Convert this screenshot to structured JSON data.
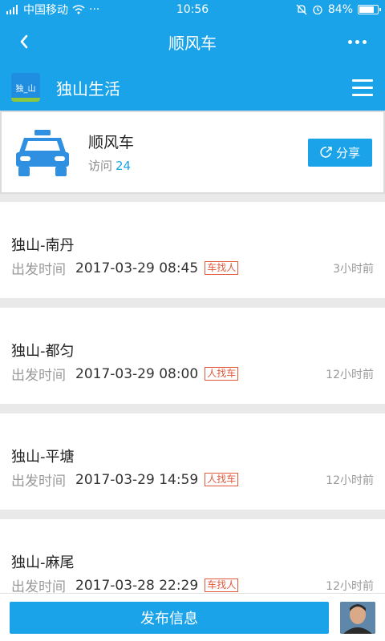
{
  "status_bar": {
    "carrier": "中国移动",
    "time": "10:56",
    "battery_percent": "84%",
    "battery_level": 0.84,
    "icons": [
      "signal-icon",
      "wifi-icon",
      "more-dots-icon",
      "mute-icon",
      "alarm-icon",
      "battery-icon"
    ]
  },
  "titlebar": {
    "title": "顺风车",
    "back_icon": "chevron-left-icon",
    "more_icon": "more-dots-icon"
  },
  "appbar": {
    "logo_text": "独_山",
    "app_name": "独山生活",
    "menu_icon": "hamburger-icon"
  },
  "header_card": {
    "icon": "taxi-icon",
    "title": "顺风车",
    "visit_label": "访问",
    "visit_count": "24",
    "share_label": "分享",
    "share_icon": "share-icon"
  },
  "trips": [
    {
      "route": "独山-南丹",
      "time_label": "出发时间",
      "time": "2017-03-29 08:45",
      "tag": "车找人",
      "ago": "3小时前"
    },
    {
      "route": "独山-都匀",
      "time_label": "出发时间",
      "time": "2017-03-29 08:00",
      "tag": "人找车",
      "ago": "12小时前"
    },
    {
      "route": "独山-平塘",
      "time_label": "出发时间",
      "time": "2017-03-29 14:59",
      "tag": "人找车",
      "ago": "12小时前"
    },
    {
      "route": "独山-麻尾",
      "time_label": "出发时间",
      "time": "2017-03-28 22:29",
      "tag": "车找人",
      "ago": "12小时前"
    }
  ],
  "bottom": {
    "publish_label": "发布信息",
    "avatar_icon": "avatar-icon"
  },
  "colors": {
    "primary": "#1aa3e8",
    "tag": "#e2583b",
    "logo_accent": "#8dc63f"
  }
}
